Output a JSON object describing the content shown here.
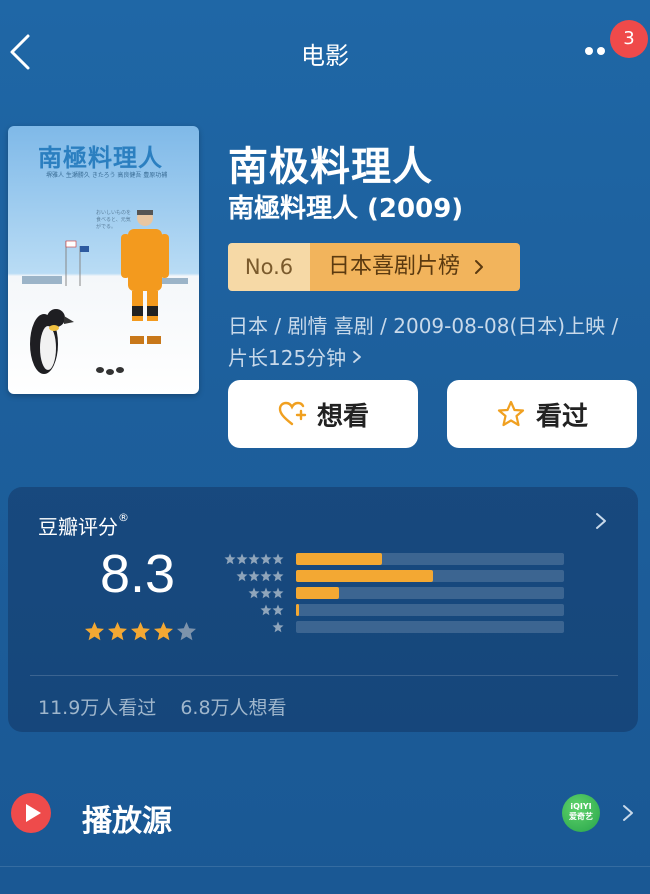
{
  "header": {
    "title": "电影",
    "back_icon": "chevron-left-icon",
    "more_icon": "more-dots-icon",
    "notification_count": "3"
  },
  "poster": {
    "title": "南極料理人",
    "credits": "堺雅人 生瀬勝久 きたろう 高良健吾 豊原功補",
    "tagline": "おいしいものを食べると、元気がでる。"
  },
  "movie": {
    "title_cn": "南极料理人",
    "title_original": "南極料理人 (2009)",
    "rank_no": "No.6",
    "rank_list": "日本喜剧片榜",
    "meta_line1": "日本 / 剧情 喜剧 / 2009-08-08(日本)上映 /",
    "meta_line2": "片长125分钟"
  },
  "actions": {
    "want_label": "想看",
    "seen_label": "看过",
    "want_icon": "heart-plus-icon",
    "seen_icon": "star-outline-icon"
  },
  "rating": {
    "label": "豆瓣评分",
    "registered_mark": "®",
    "score": "8.3",
    "star_value": 4.0,
    "stars_total": 5,
    "distribution": [
      {
        "stars": 5,
        "fraction": 0.32
      },
      {
        "stars": 4,
        "fraction": 0.51
      },
      {
        "stars": 3,
        "fraction": 0.16
      },
      {
        "stars": 2,
        "fraction": 0.01
      },
      {
        "stars": 1,
        "fraction": 0.0
      }
    ],
    "seen_count": "11.9万人看过",
    "want_count": "6.8万人想看"
  },
  "play_source": {
    "label": "播放源",
    "provider_line1": "iQIYI",
    "provider_line2": "爱奇艺"
  },
  "colors": {
    "background": "#1f67a6",
    "accent_orange": "#f3a833",
    "badge_red": "#ef4a4a",
    "rank_light": "#f6d9a6",
    "rank_dark": "#f2b45c"
  }
}
